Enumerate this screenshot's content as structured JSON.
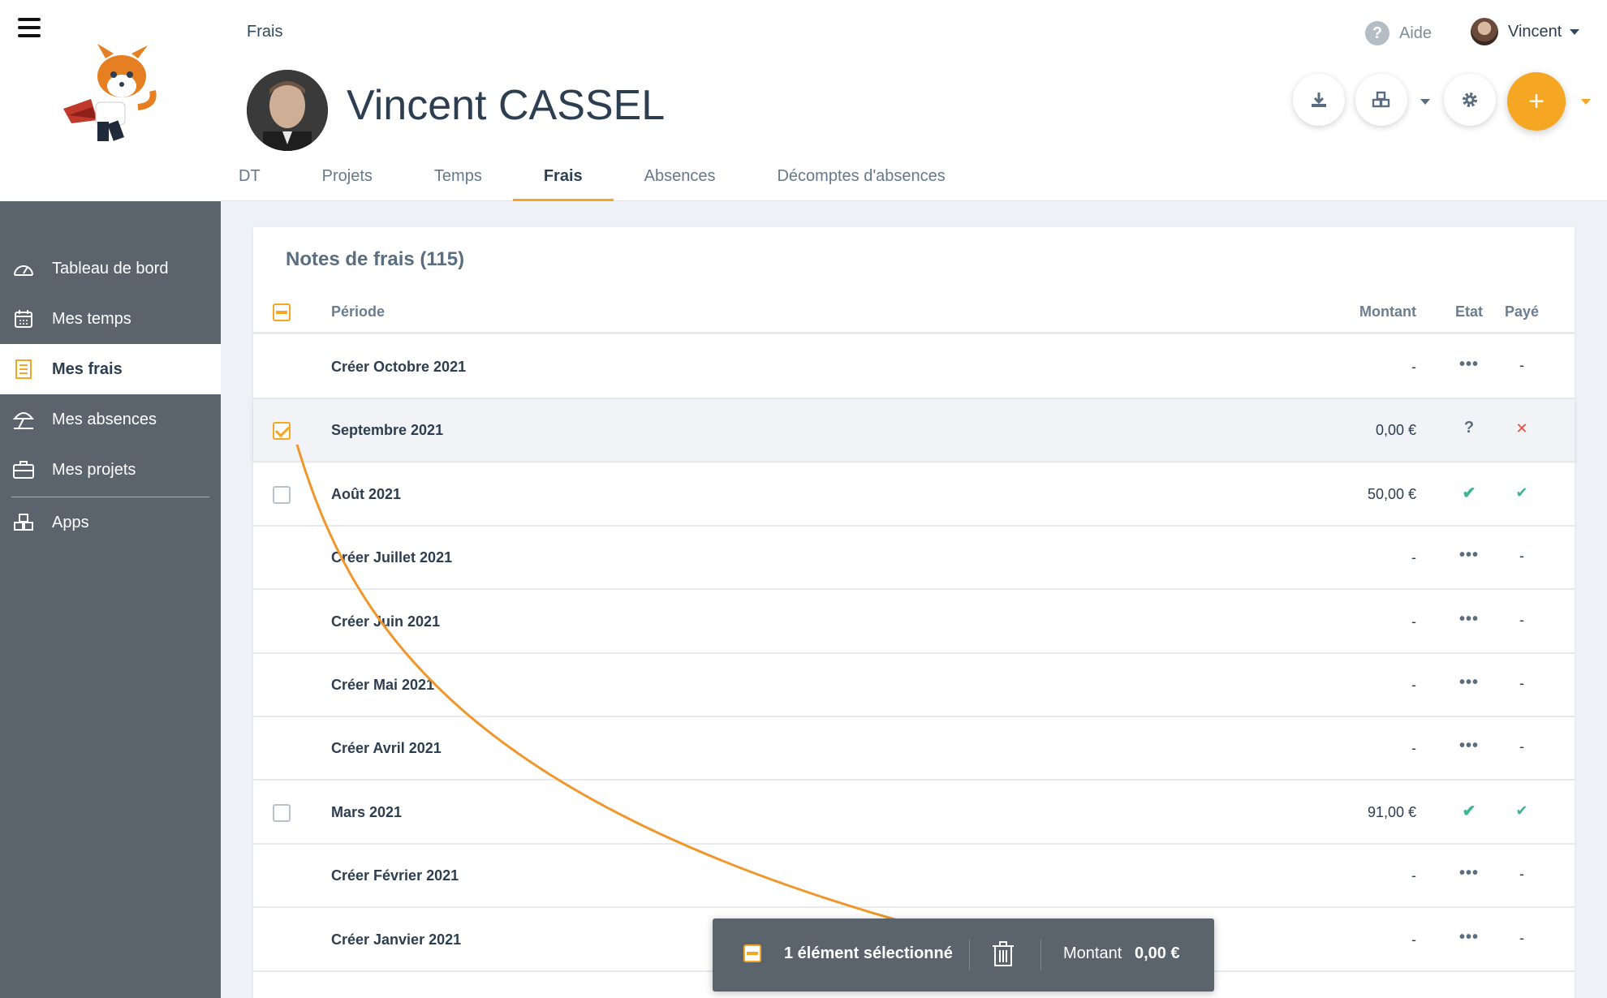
{
  "sidebar": {
    "items": [
      {
        "label": "Tableau de bord",
        "icon": "dashboard-gauge-icon",
        "active": false
      },
      {
        "label": "Mes temps",
        "icon": "calendar-icon",
        "active": false
      },
      {
        "label": "Mes frais",
        "icon": "receipt-icon",
        "active": true
      },
      {
        "label": "Mes absences",
        "icon": "beach-umbrella-icon",
        "active": false
      },
      {
        "label": "Mes projets",
        "icon": "briefcase-icon",
        "active": false
      },
      {
        "label": "Apps",
        "icon": "cubes-icon",
        "active": false
      }
    ]
  },
  "header": {
    "breadcrumb": "Frais",
    "help_label": "Aide",
    "user_name": "Vincent",
    "profile_name": "Vincent CASSEL",
    "tabs": [
      {
        "label": "DT",
        "active": false
      },
      {
        "label": "Projets",
        "active": false
      },
      {
        "label": "Temps",
        "active": false
      },
      {
        "label": "Frais",
        "active": true
      },
      {
        "label": "Absences",
        "active": false
      },
      {
        "label": "Décomptes d'absences",
        "active": false
      }
    ]
  },
  "table": {
    "title": "Notes de frais (115)",
    "columns": {
      "period": "Période",
      "amount": "Montant",
      "state": "Etat",
      "paid": "Payé"
    },
    "rows": [
      {
        "period": "Créer Octobre 2021",
        "amount": "-",
        "state": "•••",
        "paid": "-",
        "checkbox": "none",
        "selected": false
      },
      {
        "period": "Septembre 2021",
        "amount": "0,00 €",
        "state": "?",
        "paid": "✕",
        "checkbox": "checked",
        "selected": true
      },
      {
        "period": "Août 2021",
        "amount": "50,00 €",
        "state": "✔",
        "paid": "✔",
        "checkbox": "unchecked",
        "selected": false
      },
      {
        "period": "Créer Juillet 2021",
        "amount": "-",
        "state": "•••",
        "paid": "-",
        "checkbox": "none",
        "selected": false
      },
      {
        "period": "Créer Juin 2021",
        "amount": "-",
        "state": "•••",
        "paid": "-",
        "checkbox": "none",
        "selected": false
      },
      {
        "period": "Créer Mai 2021",
        "amount": "-",
        "state": "•••",
        "paid": "-",
        "checkbox": "none",
        "selected": false
      },
      {
        "period": "Créer Avril 2021",
        "amount": "-",
        "state": "•••",
        "paid": "-",
        "checkbox": "none",
        "selected": false
      },
      {
        "period": "Mars 2021",
        "amount": "91,00 €",
        "state": "✔",
        "paid": "✔",
        "checkbox": "unchecked",
        "selected": false
      },
      {
        "period": "Créer Février 2021",
        "amount": "-",
        "state": "•••",
        "paid": "-",
        "checkbox": "none",
        "selected": false
      },
      {
        "period": "Créer Janvier 2021",
        "amount": "-",
        "state": "•••",
        "paid": "-",
        "checkbox": "none",
        "selected": false
      }
    ]
  },
  "selection_bar": {
    "text": "1 élément sélectionné",
    "amount_label": "Montant",
    "amount_value": "0,00 €"
  },
  "colors": {
    "accent": "#f5a623",
    "sidebar_bg": "#5b636c",
    "success": "#3fb68b",
    "danger": "#e74c3c"
  }
}
